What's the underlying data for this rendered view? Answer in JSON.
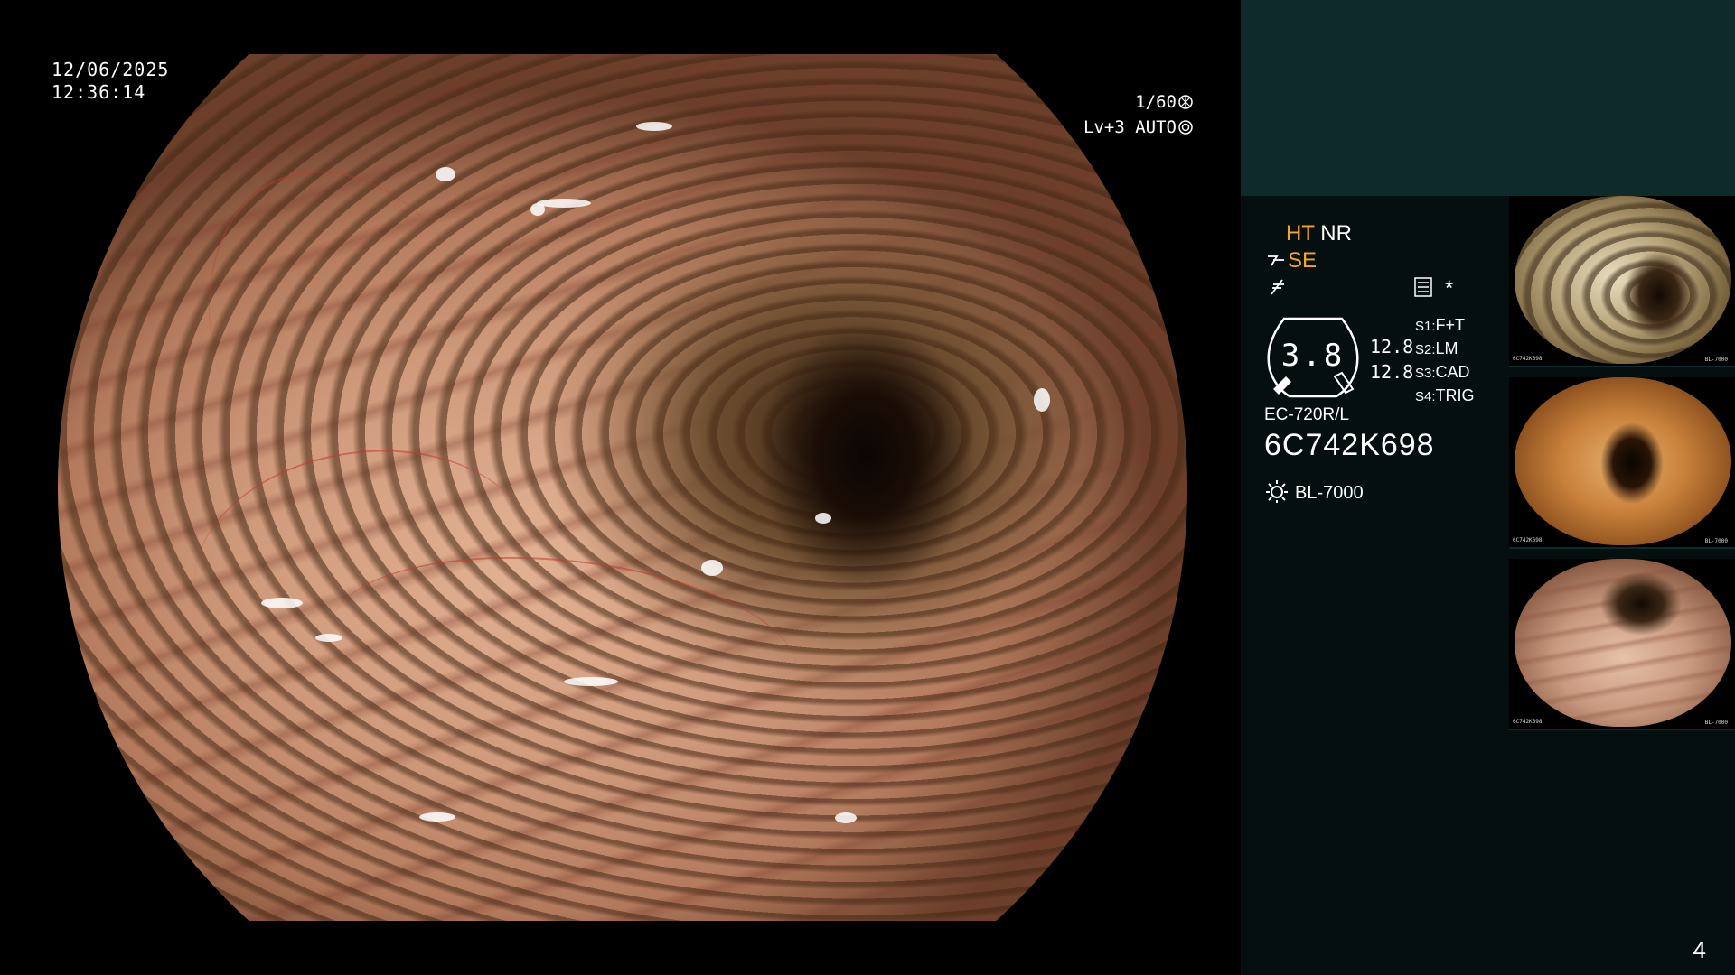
{
  "overlay": {
    "date": "12/06/2025",
    "time": "12:36:14",
    "shutter": "1/60",
    "level": "Lv+3 AUTO"
  },
  "panel": {
    "mode_ht": "HT",
    "mode_nr": "NR",
    "mode_se": "SE",
    "star": "*",
    "gauge_value": "3.8",
    "gauge_val_1": "12.8",
    "gauge_val_2": "12.8",
    "settings": [
      {
        "key": "S1:",
        "value": "F+T"
      },
      {
        "key": "S2:",
        "value": "LM"
      },
      {
        "key": "S3:",
        "value": "CAD"
      },
      {
        "key": "S4:",
        "value": "TRIG"
      }
    ],
    "scope_model": "EC-720R/L",
    "serial": "6C742K698",
    "light_source": "BL-7000"
  },
  "thumbnails": [
    {
      "caption": "6C742K698",
      "source": "BL-7000"
    },
    {
      "caption": "6C742K698",
      "source": "BL-7000"
    },
    {
      "caption": "6C742K698",
      "source": "BL-7000"
    }
  ],
  "page_number": "4",
  "colors": {
    "accent": "#f5a623",
    "panel_bg": "#050f0f",
    "panel_top": "#0e2a2a"
  }
}
